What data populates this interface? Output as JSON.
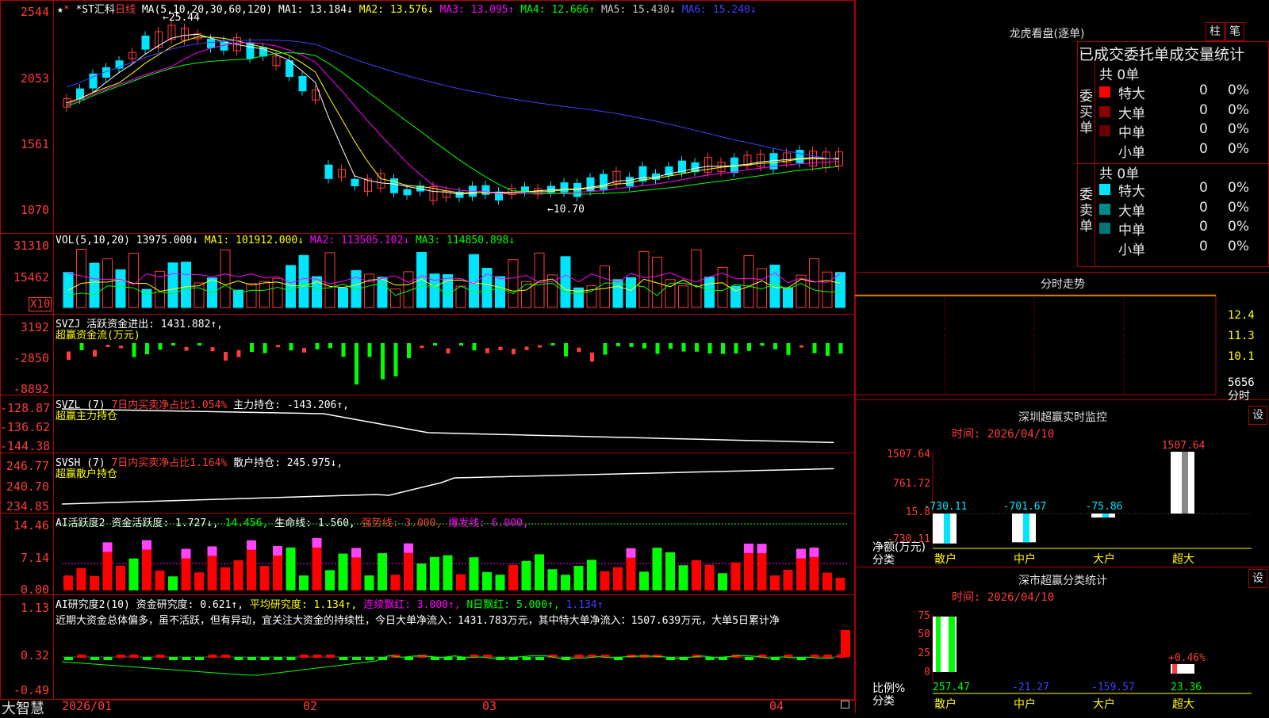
{
  "app": {
    "brand": "大智慧"
  },
  "kline": {
    "stock": "*ST汇科",
    "period": "日线",
    "ma_params": "MA(5,10,20,30,60,120)",
    "ma1": "MA1: 13.184↓",
    "ma2": "MA2: 13.576↓",
    "ma3": "MA3: 13.095↑",
    "ma4": "MA4: 12.666↑",
    "ma5": "MA5: 15.430↓",
    "ma6": "MA6: 15.240↓",
    "high_label": "25.44",
    "low_label": "10.70",
    "y_ticks": [
      "2544",
      "2053",
      "1561",
      "1070"
    ]
  },
  "vol": {
    "header": "VOL(5,10,20)",
    "value": "13975.000↓",
    "ma1": "MA1: 101912.000↓",
    "ma2": "MA2: 113505.102↓",
    "ma3": "MA3: 114850.898↓",
    "y_ticks": [
      "31310",
      "15462"
    ],
    "unit": "X10"
  },
  "svzj": {
    "header": "SVZJ",
    "label": "活跃资金进出: 1431.882↑,",
    "sub": "超赢资金流(万元)",
    "y_ticks": [
      "3192",
      "-2850",
      "-8892"
    ]
  },
  "svzl": {
    "header": "SVZL (7)",
    "ratio": "7日内买卖净占比1.054%",
    "main": "主力持仓: -143.206↑,",
    "sub": "超赢主力持仓",
    "y_ticks": [
      "-128.87",
      "-136.62",
      "-144.38"
    ]
  },
  "svsh": {
    "header": "SVSH (7)",
    "ratio": "7日内买卖净占比1.164%",
    "main": "散户持仓: 245.975↓,",
    "sub": "超赢散户持仓",
    "y_ticks": [
      "246.77",
      "240.70",
      "234.85"
    ]
  },
  "ai1": {
    "header": "AI活跃度2",
    "a": "资金活跃度: 1.727↓,",
    "b": "14.456,",
    "c": "生命线: 1.560,",
    "d": "强势线: 3.000,",
    "e": "爆发线: 6.000,",
    "y_ticks": [
      "14.46",
      "7.14",
      "0.00"
    ]
  },
  "ai2": {
    "header": "AI研究度2(10)",
    "a": "资金研究度: 0.621↑,",
    "b": "平均研究度: 1.134↑,",
    "c": "连续飘红: 3.000↑,",
    "d": "N日飘红: 5.000↑,",
    "e": "1.134↑",
    "comment": "近期大资金总体偏多，虽不活跃，但有异动，宜关注大资金的持续性，今日大单净流入：1431.783万元，其中特大单净流入：1507.639万元，大单5日累计净",
    "y_ticks": [
      "1.13",
      "0.32",
      "-0.49"
    ]
  },
  "xaxis": {
    "labels": [
      "2026/01",
      "02",
      "03",
      "04"
    ]
  },
  "right": {
    "lhb_title": "龙虎看盘(逐单)",
    "btn_zhu": "柱",
    "btn_bi": "笔",
    "table_title": "已成交委托单成交量统计",
    "buy_side": {
      "label": "委买单",
      "total": "共 0单",
      "rows": [
        {
          "name": "特大",
          "val": "0",
          "pct": "0%",
          "color": "#ff0000"
        },
        {
          "name": "大单",
          "val": "0",
          "pct": "0%",
          "color": "#8b0000"
        },
        {
          "name": "中单",
          "val": "0",
          "pct": "0%",
          "color": "#6b0000"
        },
        {
          "name": "小单",
          "val": "0",
          "pct": "0%",
          "color": ""
        }
      ]
    },
    "sell_side": {
      "label": "委卖单",
      "total": "共 0单",
      "rows": [
        {
          "name": "特大",
          "val": "0",
          "pct": "0%",
          "color": "#00e5ff"
        },
        {
          "name": "大单",
          "val": "0",
          "pct": "0%",
          "color": "#008b8b"
        },
        {
          "name": "中单",
          "val": "0",
          "pct": "0%",
          "color": "#007777"
        },
        {
          "name": "小单",
          "val": "0",
          "pct": "0%",
          "color": ""
        }
      ]
    },
    "fenshi": {
      "title": "分时走势",
      "prices": [
        "12.4",
        "11.3",
        "10.1"
      ],
      "vol": "5656",
      "vol_label": "分时"
    },
    "monitor": {
      "title": "深圳超赢实时监控",
      "btn": "设",
      "time": "时间: 2026/04/10",
      "y_ticks": [
        "1507.64",
        "761.72",
        "15.8",
        "-730.11"
      ],
      "ylabel": "净额(万元)",
      "xlabel": "分类",
      "cats": [
        "散户",
        "中户",
        "大户",
        "超大"
      ],
      "values": [
        -730.11,
        -701.67,
        -75.86,
        1507.64
      ],
      "labels": [
        "-730.11",
        "-701.67",
        "-75.86",
        "1507.64"
      ]
    },
    "classify": {
      "title": "深市超赢分类统计",
      "btn": "设",
      "time": "时间: 2026/04/10",
      "y_ticks": [
        "75",
        "50",
        "25",
        "0"
      ],
      "ylabel": "比例%",
      "xlabel": "分类",
      "cats": [
        "散户",
        "中户",
        "大户",
        "超大"
      ],
      "values": [
        257.47,
        -21.27,
        -159.57,
        23.36
      ],
      "labels": [
        "257.47",
        "-21.27",
        "-159.57",
        "23.36"
      ],
      "note": "+0.46%"
    }
  }
}
